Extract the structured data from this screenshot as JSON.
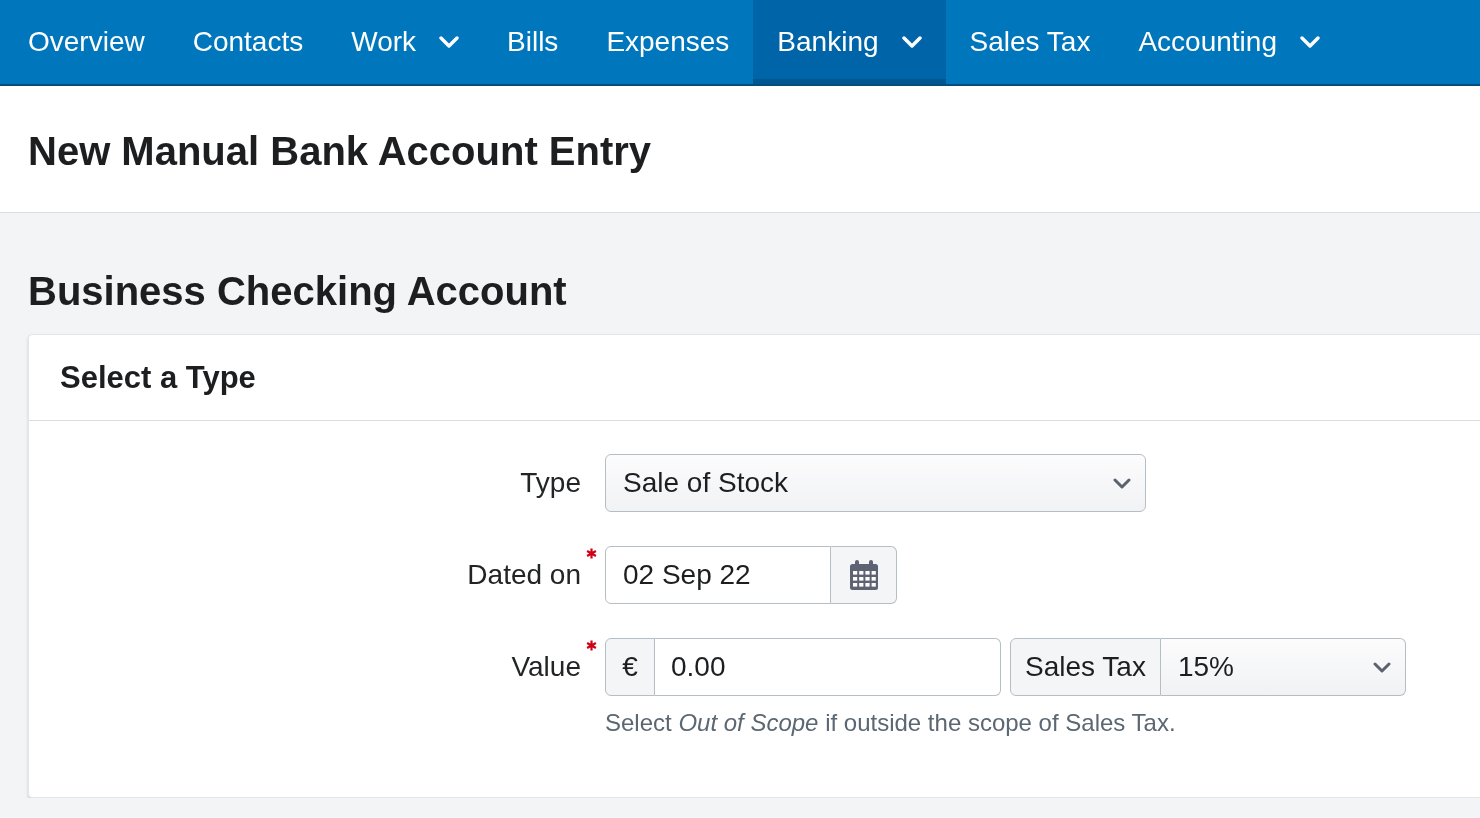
{
  "nav": {
    "items": [
      {
        "label": "Overview",
        "has_menu": false,
        "selected": false
      },
      {
        "label": "Contacts",
        "has_menu": false,
        "selected": false
      },
      {
        "label": "Work",
        "has_menu": true,
        "selected": false
      },
      {
        "label": "Bills",
        "has_menu": false,
        "selected": false
      },
      {
        "label": "Expenses",
        "has_menu": false,
        "selected": false
      },
      {
        "label": "Banking",
        "has_menu": true,
        "selected": true
      },
      {
        "label": "Sales Tax",
        "has_menu": false,
        "selected": false
      },
      {
        "label": "Accounting",
        "has_menu": true,
        "selected": false
      }
    ]
  },
  "page_header": {
    "title": "New Manual Bank Account Entry"
  },
  "account": {
    "name": "Business Checking Account"
  },
  "card": {
    "title": "Select a Type",
    "fields": [
      {
        "kind": "select",
        "label": "Type",
        "required": false,
        "value": "Sale of Stock"
      },
      {
        "kind": "date",
        "label": "Dated on",
        "required": true,
        "value": "02 Sep 22"
      },
      {
        "kind": "money",
        "label": "Value",
        "required": true,
        "currency": "€",
        "value": "0.00",
        "tax_label": "Sales Tax",
        "tax_value": "15%",
        "help": "Select *Out of Scope* if outside the scope of Sales Tax."
      }
    ]
  }
}
